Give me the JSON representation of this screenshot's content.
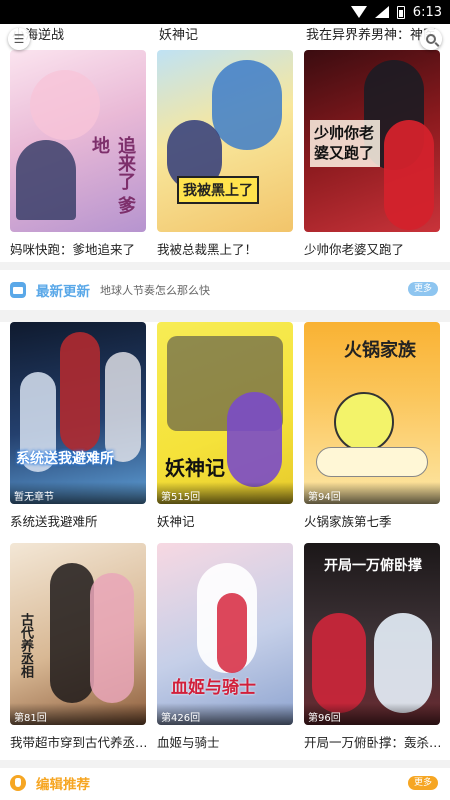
{
  "status_bar": {
    "time": "6:13"
  },
  "partial_titles": [
    "小海逆战",
    "妖神记",
    "我在异界养男神：神医"
  ],
  "row1": [
    {
      "title": "妈咪快跑：爹地追来了",
      "cover_text": "追来了 爹地",
      "palette": [
        "#f6d5e6",
        "#c9a0dc"
      ]
    },
    {
      "title": "我被总裁黑上了！",
      "cover_text": "我被黑上了",
      "palette": [
        "#f4e8a8",
        "#8fc8e8"
      ]
    },
    {
      "title": "少帅你老婆又跑了",
      "cover_text": "少帅你老婆又跑了",
      "palette": [
        "#6b1414",
        "#e9dccb"
      ]
    }
  ],
  "section_latest": {
    "title": "最新更新",
    "subtitle": "地球人节奏怎么那么快",
    "more": "更多",
    "color": "#5aa8e8"
  },
  "row2": [
    {
      "title": "系统送我避难所",
      "badge": "暂无章节",
      "cover_text": "系统送我避难所",
      "palette": [
        "#1d2a44",
        "#3a6fb0"
      ]
    },
    {
      "title": "妖神记",
      "badge": "第515回",
      "cover_text": "妖神记",
      "palette": [
        "#f3e35d",
        "#6a4bb0"
      ]
    },
    {
      "title": "火锅家族第七季",
      "badge": "第94回",
      "cover_text": "火锅家族",
      "palette": [
        "#f7b733",
        "#ffe39b"
      ]
    }
  ],
  "row3": [
    {
      "title": "我带超市穿到古代养丞…",
      "badge": "第81回",
      "cover_text": "古代养丞相",
      "palette": [
        "#e8d7c2",
        "#9a6b4a"
      ]
    },
    {
      "title": "血姬与骑士",
      "badge": "第426回",
      "cover_text": "血姬与骑士",
      "palette": [
        "#f5d0da",
        "#a8b6d6"
      ]
    },
    {
      "title": "开局一万俯卧撑：轰杀…",
      "badge": "第96回",
      "cover_text": "开局一万俯卧撑",
      "palette": [
        "#2a2426",
        "#a0243a"
      ]
    }
  ],
  "section_editor": {
    "title": "编辑推荐",
    "more": "更多",
    "color": "#f6a623"
  }
}
